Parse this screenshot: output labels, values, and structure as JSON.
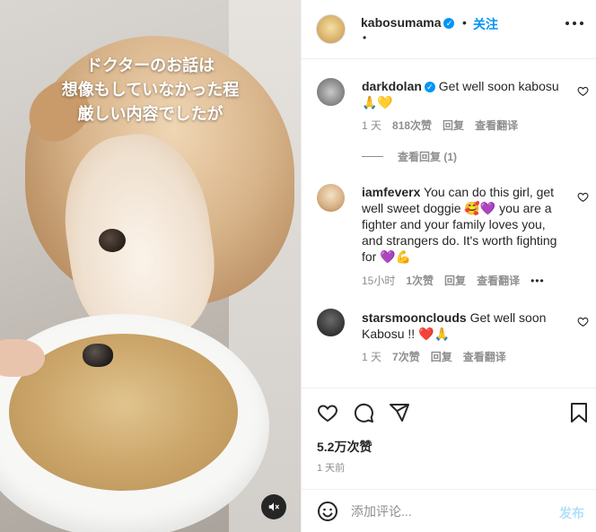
{
  "media": {
    "caption": "ドクターのお話は\n想像もしていなかった程\n厳しい内容でしたが",
    "mute_icon": "speaker-muted-icon"
  },
  "header": {
    "username": "kabosumama",
    "dot": "•",
    "follow_label": "关注",
    "subline": "•"
  },
  "comments": [
    {
      "username": "darkdolan",
      "text": "Get well soon kabosu 🙏💛",
      "time": "1 天",
      "likes": "818次赞",
      "reply": "回复",
      "translate": "查看翻译",
      "view_replies": "查看回复 (1)"
    },
    {
      "username": "iamfeverx",
      "text": "You can do this girl, get well sweet doggie 🥰💜 you are a fighter and your family loves you, and strangers do. It's worth fighting for 💜💪",
      "time": "15小时",
      "likes": "1次赞",
      "reply": "回复",
      "translate": "查看翻译",
      "more": "•••"
    },
    {
      "username": "starsmoonclouds",
      "text": "Get well soon Kabosu !! ❤️🙏",
      "time": "1 天",
      "likes": "7次赞",
      "reply": "回复",
      "translate": "查看翻译"
    }
  ],
  "stats": {
    "likes": "5.2万次赞",
    "date": "1 天前"
  },
  "composer": {
    "placeholder": "添加评论...",
    "post_label": "发布"
  },
  "colors": {
    "accent": "#0095f6",
    "muted": "#8e8e8e",
    "text": "#262626",
    "post_disabled": "#b2dffc"
  }
}
